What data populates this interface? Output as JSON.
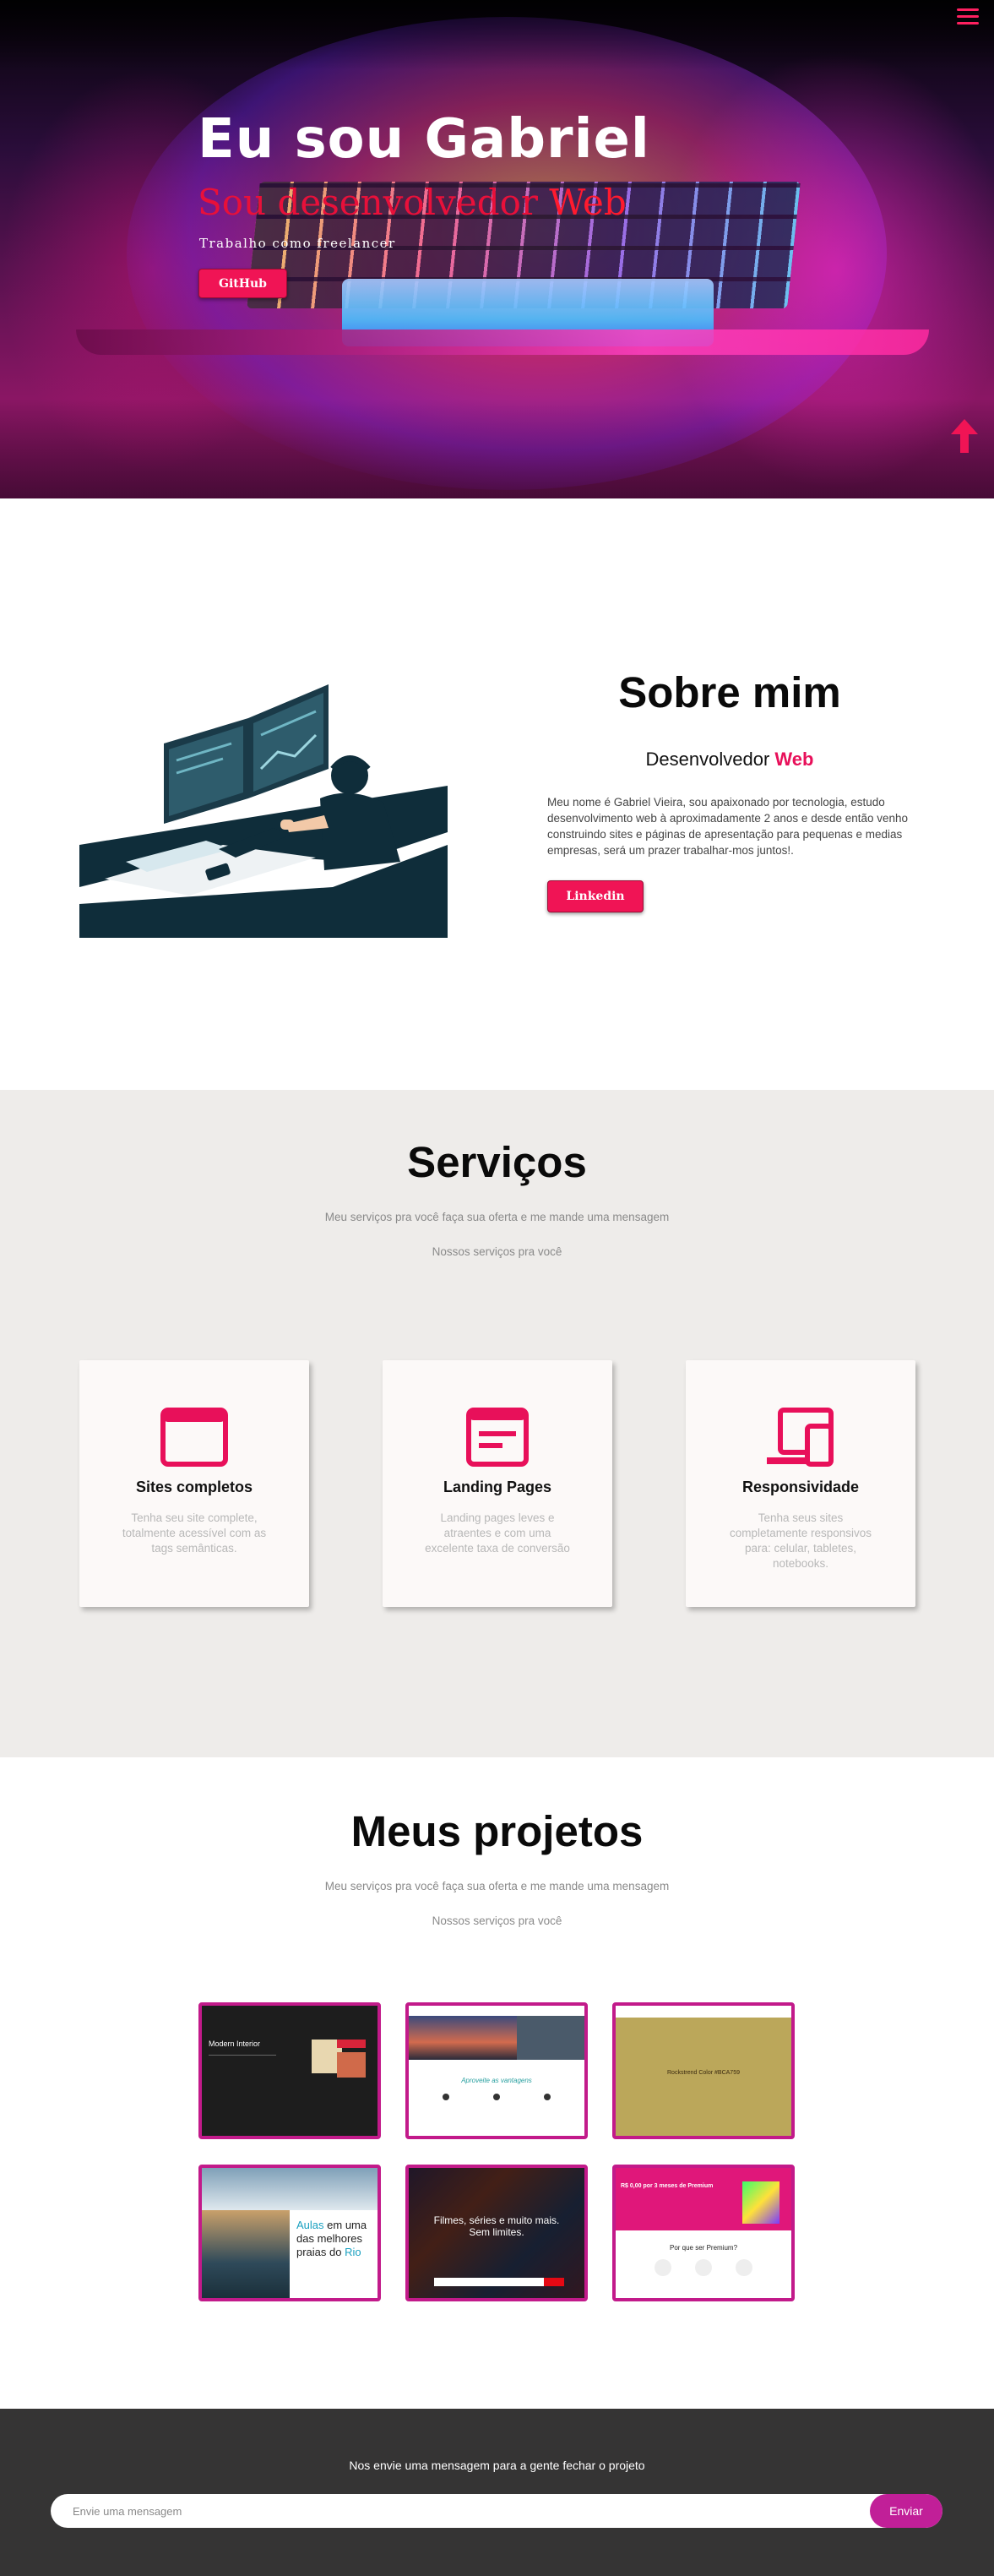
{
  "hero": {
    "title": "Eu sou Gabriel",
    "subtitle_prefix": "Sou desenvolvedor ",
    "subtitle_accent": "Web",
    "tagline": "Trabalho como freelancer",
    "github_label": "GitHub"
  },
  "about": {
    "title": "Sobre mim",
    "role_prefix": "Desenvolvedor ",
    "role_accent": "Web",
    "text": "Meu nome é Gabriel Vieira, sou apaixonado por tecnologia, estudo desenvolvimento web à aproximadamente 2 anos e desde então venho construindo sites e páginas de apresentação para pequenas e medias empresas, será um prazer trabalhar-mos juntos!.",
    "linkedin_label": "Linkedin"
  },
  "services": {
    "title": "Serviços",
    "subtitle1": "Meu serviços pra você faça sua oferta e me mande uma mensagem",
    "subtitle2": "Nossos serviços pra você",
    "cards": [
      {
        "icon": "browser-window-icon",
        "title": "Sites completos",
        "text": "Tenha seu site complete, totalmente acessível com as tags semânticas."
      },
      {
        "icon": "document-icon",
        "title": "Landing Pages",
        "text": "Landing pages leves e atraentes e com uma excelente taxa de conversão"
      },
      {
        "icon": "devices-icon",
        "title": "Responsividade",
        "text": "Tenha seus sites completamente responsivos para: celular, tabletes, notebooks."
      }
    ]
  },
  "projects": {
    "title": "Meus projetos",
    "subtitle1": "Meu serviços pra você faça sua oferta e me mande uma mensagem",
    "subtitle2": "Nossos serviços pra você",
    "items": [
      {
        "caption": "Modern Interior"
      },
      {
        "caption": "Aproveite as vantagens"
      },
      {
        "caption": "Rockstrend Color #BCA759"
      },
      {
        "caption_a": "Aulas",
        "caption_b": " em uma das melhores praias do ",
        "caption_c": "Rio"
      },
      {
        "caption": "Filmes, séries e muito mais. Sem limites."
      },
      {
        "caption": "R$ 0,00 por 3 meses de Premium",
        "caption2": "Por que ser Premium?"
      }
    ]
  },
  "footer": {
    "text": "Nos envie uma mensagem para a gente fechar o projeto",
    "placeholder": "Envie uma mensagem",
    "send_label": "Enviar"
  },
  "colors": {
    "accent": "#f01455",
    "project_border": "#c21a8a",
    "send": "#c11f98",
    "footer_bg": "#353434",
    "services_bg": "#eeecea"
  }
}
